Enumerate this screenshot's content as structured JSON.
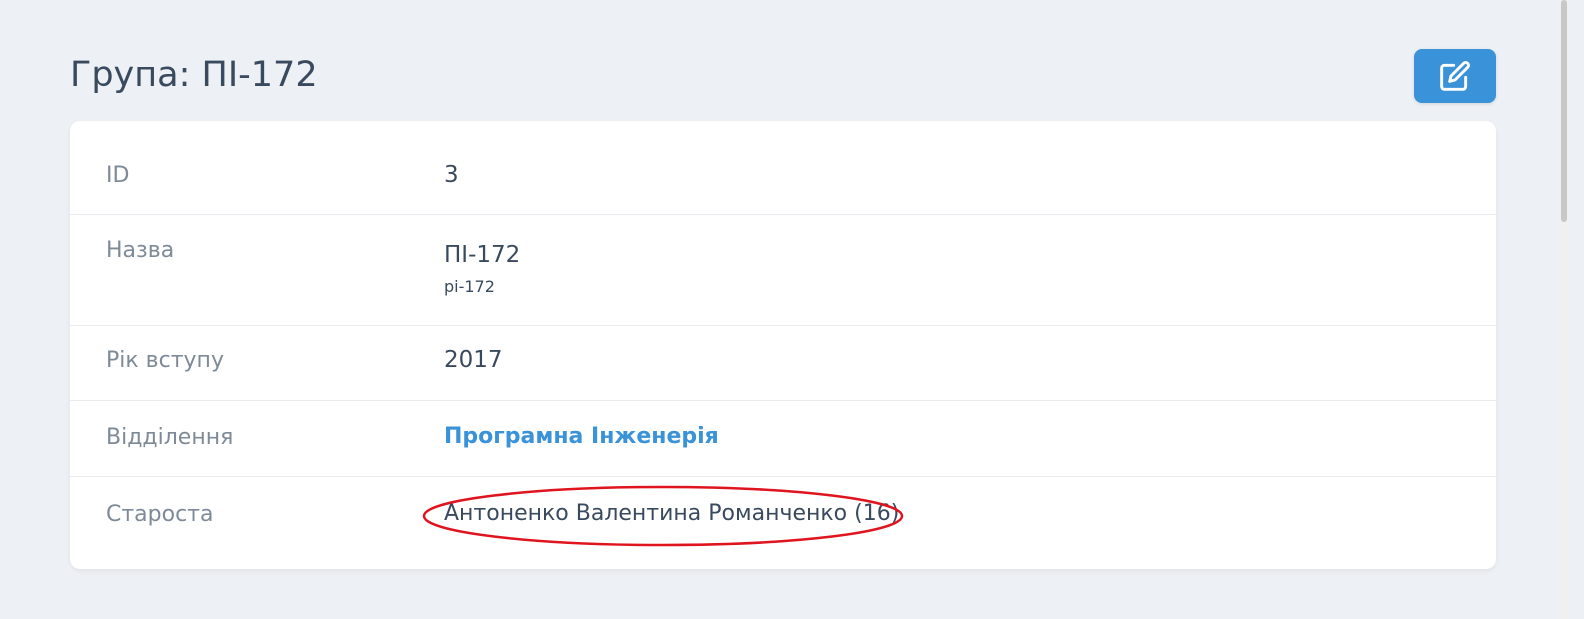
{
  "header": {
    "title": "Група: ПІ-172",
    "edit_icon": "pencil-square-icon"
  },
  "details": {
    "id": {
      "label": "ID",
      "value": "3"
    },
    "name": {
      "label": "Назва",
      "value": "ПІ-172",
      "slug": "pi-172"
    },
    "year": {
      "label": "Рік вступу",
      "value": "2017"
    },
    "department": {
      "label": "Відділення",
      "value": "Програмна Інженерія"
    },
    "headman": {
      "label": "Староста",
      "value": "Антоненко Валентина Романченко (16)"
    }
  },
  "colors": {
    "accent": "#3a92d9",
    "highlight": "#e0141e",
    "background": "#edf0f4"
  }
}
